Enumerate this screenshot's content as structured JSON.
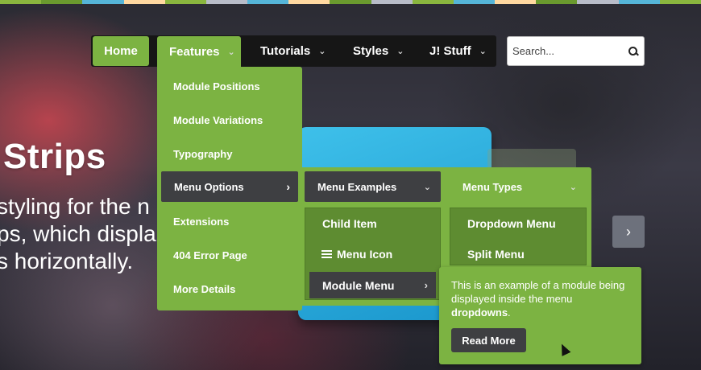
{
  "colors": {
    "accent": "#7cb342",
    "accent_dark": "#5e8c31",
    "active_item": "#3e3f42",
    "nav_bg": "#161616"
  },
  "top_strip": [
    "#8ab63e",
    "#6a9a2e",
    "#55b5d8",
    "#ffd8a0",
    "#8ab63e",
    "#b8bcc8",
    "#55b5d8",
    "#ffd8a0",
    "#6a9a2e",
    "#b8bcc8",
    "#8ab63e",
    "#55b5d8",
    "#ffd8a0",
    "#6a9a2e",
    "#b8bcc8",
    "#55b5d8",
    "#8ab63e"
  ],
  "nav": {
    "home": "Home",
    "features": "Features",
    "tutorials": "Tutorials",
    "styles": "Styles",
    "jstuff": "J! Stuff",
    "chevron": "⌄"
  },
  "search": {
    "placeholder": "Search...",
    "icon": "search-icon"
  },
  "features_menu": {
    "items": [
      "Module Positions",
      "Module Variations",
      "Typography",
      "Menu Options",
      "Extensions",
      "404 Error Page",
      "More Details"
    ],
    "active": "Menu Options",
    "active_arrow": "›"
  },
  "menu_options_submenu": {
    "menu_examples": "Menu Examples",
    "menu_types": "Menu Types",
    "examples": [
      "Child Item",
      "Menu Icon",
      "Module Menu"
    ],
    "types": [
      "Dropdown Menu",
      "Split Menu"
    ]
  },
  "module_panel": {
    "text_before": "This is an example of a module being displayed inside the menu ",
    "text_bold": "dropdowns",
    "text_after": ".",
    "button": "Read More"
  },
  "slide": {
    "title": "Strips",
    "lines": [
      "styling for the n",
      "ps, which displa",
      "s horizontally."
    ]
  },
  "next_arrow": "›"
}
